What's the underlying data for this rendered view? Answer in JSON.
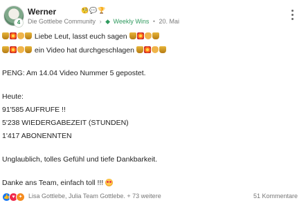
{
  "post": {
    "author": "Werner",
    "avatar_badge": "4",
    "author_badges": "🧐💬🏆",
    "community": "Die Gottlebe Community",
    "space": "Weekly Wins",
    "date": "20. Mai",
    "menu_icon": "kebab-menu-icon",
    "lines": [
      "Liebe Leut, lasst euch sagen",
      "ein Video hat durchgeschlagen",
      "PENG: Am  14.04 Video Nummer 5 gepostet.",
      "Heute:",
      "91'585 AUFRUFE !!",
      "5'238 WIEDERGABEZEIT (STUNDEN)",
      "1'417 ABONENNTEN",
      "Unglaublich, tolles Gefühl und tiefe Dankbarkeit.",
      "Danke ans Team, einfach toll !!! "
    ],
    "reactors_text": "Lisa Gottlebe, Julia Team Gottlebe. + 73 weitere",
    "comments_text": "51 Kommentare"
  },
  "colors": {
    "accent_green": "#2f9a5e",
    "like_blue": "#1877f2",
    "love_red": "#f0284a",
    "fire_orange": "#f58b1f"
  }
}
